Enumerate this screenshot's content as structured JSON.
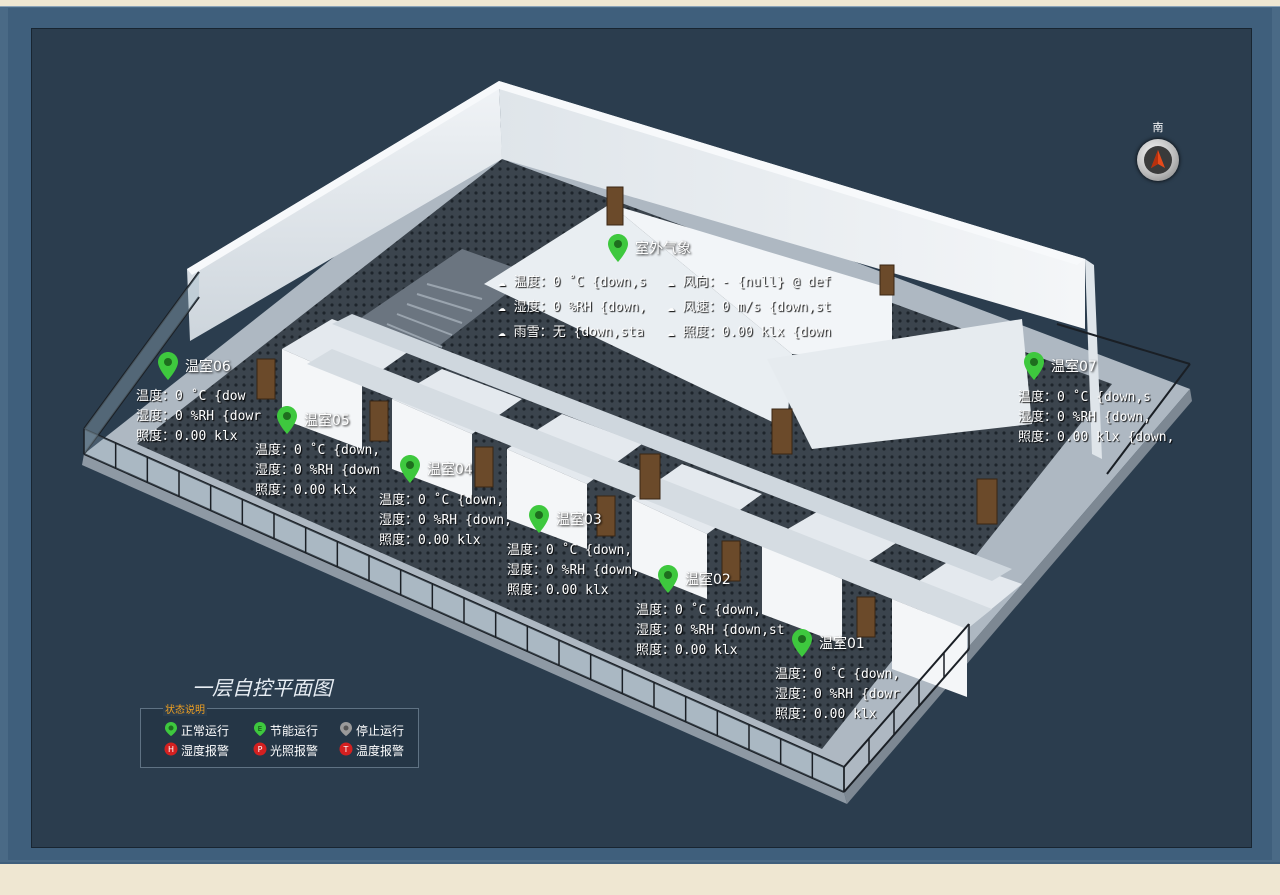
{
  "compass": {
    "label": "南"
  },
  "weather": {
    "title": "室外气象",
    "temp": {
      "label": "温度",
      "value": "0 ˚C {down,s"
    },
    "humidity": {
      "label": "湿度",
      "value": "0 %RH {down,"
    },
    "rain": {
      "label": "雨雪",
      "value": "无 {down,sta"
    },
    "wind_dir": {
      "label": "风向",
      "value": "- {null} @ def"
    },
    "wind_speed": {
      "label": "风速",
      "value": "0 m/s {down,st"
    },
    "light": {
      "label": "照度",
      "value": "0.00 klx {down"
    }
  },
  "rooms": {
    "r06": {
      "name": "温室06",
      "temp": "温度：0 ˚C {dow",
      "humid": "湿度：0 %RH {dowr",
      "lux": "照度：0.00 klx"
    },
    "r05": {
      "name": "温室05",
      "temp": "温度：0 ˚C {down,",
      "humid": "湿度：0 %RH {down",
      "lux": "照度：0.00 klx"
    },
    "r04": {
      "name": "温室04",
      "temp": "温度：0 ˚C {down,",
      "humid": "湿度：0 %RH {down,",
      "lux": "照度：0.00 klx"
    },
    "r03": {
      "name": "温室03",
      "temp": "温度：0 ˚C {down,",
      "humid": "湿度：0 %RH {down,",
      "lux": "照度：0.00 klx"
    },
    "r02": {
      "name": "温室02",
      "temp": "温度：0 ˚C {down,",
      "humid": "湿度：0 %RH {down,st",
      "lux": "照度：0.00 klx"
    },
    "r01": {
      "name": "温室01",
      "temp": "温度：0 ˚C {down,",
      "humid": "湿度：0 %RH {dowr",
      "lux": "照度：0.00 klx"
    },
    "r07": {
      "name": "温室07",
      "temp": "温度：0 ˚C {down,s",
      "humid": "湿度：0 %RH {down,",
      "lux": "照度：0.00 klx {down,"
    }
  },
  "plan_title": "一层自控平面图",
  "legend": {
    "title": "状态说明",
    "items": [
      {
        "label": "正常运行",
        "icon": "green-pin-icon",
        "color": "#3ec83e"
      },
      {
        "label": "节能运行",
        "icon": "energy-saving-E-icon",
        "color": "#3ec83e"
      },
      {
        "label": "停止运行",
        "icon": "gray-pin-icon",
        "color": "#9a9a9a"
      },
      {
        "label": "湿度报警",
        "icon": "alarm-H-icon",
        "color": "#d42020"
      },
      {
        "label": "光照报警",
        "icon": "alarm-P-icon",
        "color": "#d42020"
      },
      {
        "label": "温度报警",
        "icon": "alarm-T-icon",
        "color": "#d42020"
      }
    ]
  },
  "colors": {
    "status_normal": "#3ec83e",
    "status_alarm": "#d42020",
    "panel_bg": "#2b3d4e"
  }
}
